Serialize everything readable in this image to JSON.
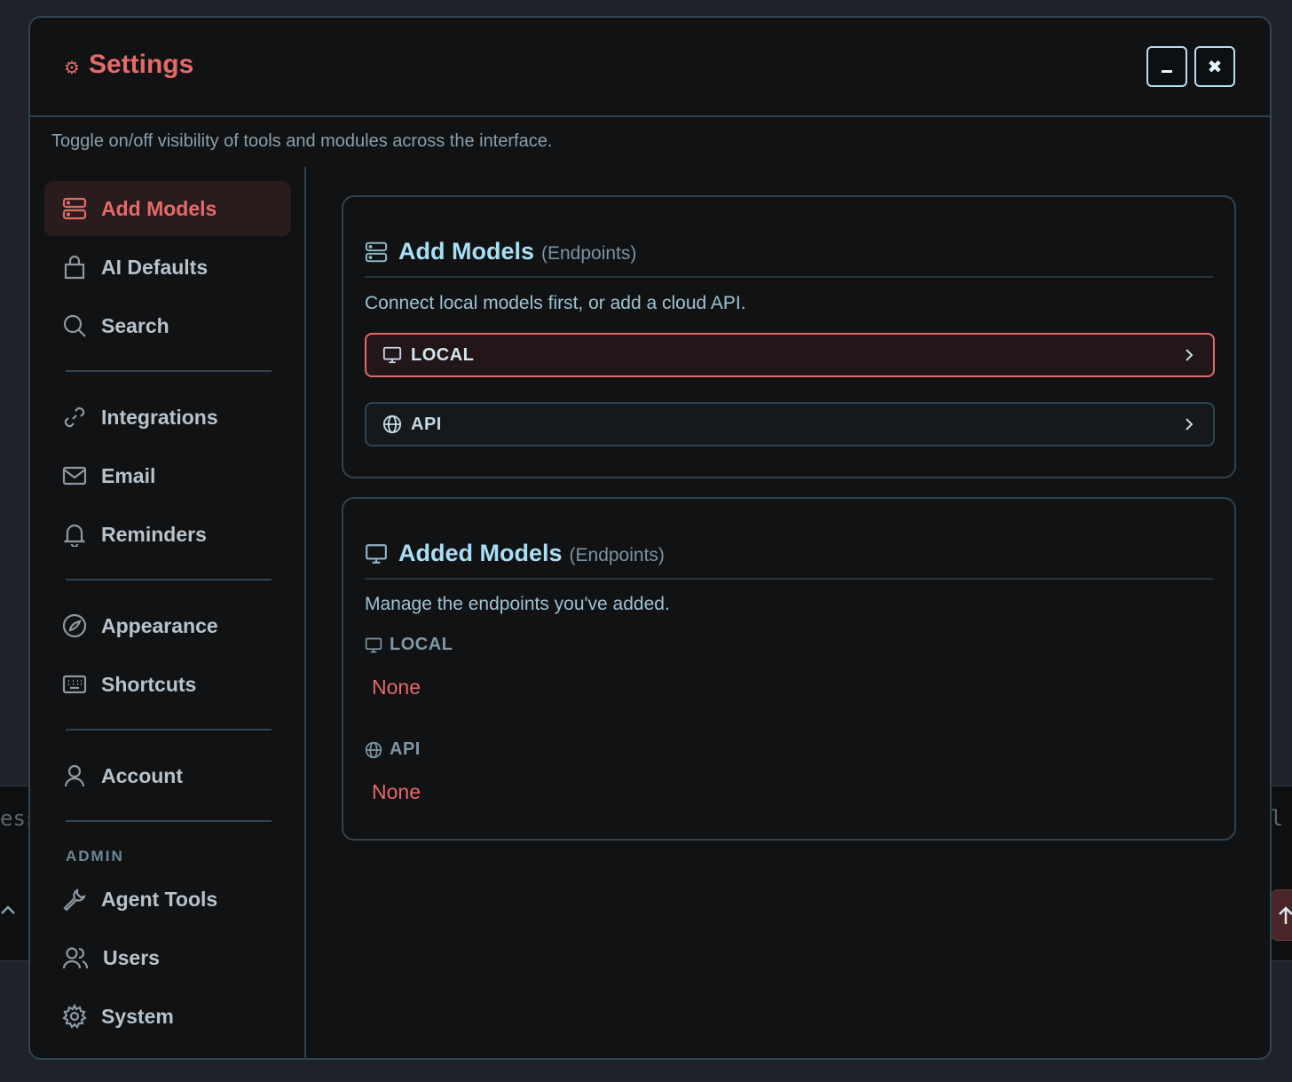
{
  "background": {
    "left_text": "ess",
    "right_text": "l"
  },
  "window": {
    "title": "Settings",
    "title_icon": "gear-icon",
    "minimize_label": "–",
    "close_label": "✖",
    "subtitle": "Toggle on/off visibility of tools and modules across the interface."
  },
  "sidebar": {
    "items": [
      {
        "label": "Add Models",
        "icon": "server-icon",
        "active": true
      },
      {
        "label": "AI Defaults",
        "icon": "bag-icon"
      },
      {
        "label": "Search",
        "icon": "search-icon"
      },
      {
        "label": "Integrations",
        "icon": "link-icon"
      },
      {
        "label": "Email",
        "icon": "mail-icon"
      },
      {
        "label": "Reminders",
        "icon": "bell-icon"
      },
      {
        "label": "Appearance",
        "icon": "palette-icon"
      },
      {
        "label": "Shortcuts",
        "icon": "keyboard-icon"
      },
      {
        "label": "Account",
        "icon": "user-icon"
      },
      {
        "label": "Agent Tools",
        "icon": "wrench-icon"
      },
      {
        "label": "Users",
        "icon": "users-icon"
      },
      {
        "label": "System",
        "icon": "cog-icon"
      }
    ],
    "admin_label": "ADMIN"
  },
  "add_models": {
    "title": "Add Models",
    "subtitle": "(Endpoints)",
    "description": "Connect local models first, or add a cloud API.",
    "local_label": "LOCAL",
    "api_label": "API"
  },
  "added_models": {
    "title": "Added Models",
    "subtitle": "(Endpoints)",
    "description": "Manage the endpoints you've added.",
    "local_label": "LOCAL",
    "local_value": "None",
    "api_label": "API",
    "api_value": "None"
  },
  "colors": {
    "accent": "#e46a6a",
    "heading": "#a9dff5",
    "border": "#2f4452"
  }
}
